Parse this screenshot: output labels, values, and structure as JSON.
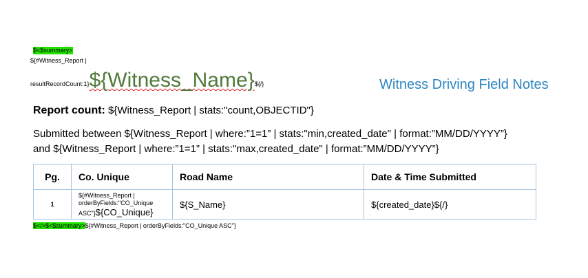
{
  "header": {
    "summary_open_tag": "$<$summary>",
    "witness_report_open_line1": "${#Witness_Report |",
    "witness_report_open_line2": "resultRecordCount:1}",
    "witness_name_field": "${Witness_Name}",
    "close_tag": "${/}",
    "title": "Witness Driving Field Notes"
  },
  "report_count": {
    "label": "Report count:",
    "expression": "${Witness_Report | stats:\"count,OBJECTID\"}"
  },
  "submitted": {
    "line1": "Submitted between ${Witness_Report | where:”1=1” | stats:\"min,created_date\" | format:”MM/DD/YYYY”}",
    "line2": "and ${Witness_Report | where:”1=1” | stats:\"max,created_date\" | format:”MM/DD/YYYY”}"
  },
  "table": {
    "headers": [
      "Pg.",
      "Co. Unique",
      "Road Name",
      "Date & Time Submitted"
    ],
    "row": {
      "pg": "1",
      "co_unique_line1": "${#Witness_Report |",
      "co_unique_line2": "orderByFields:\"CO_Unique",
      "co_unique_line3": "ASC\"}",
      "co_unique_field": "${CO_Unique}",
      "road_name": "${S_Name}",
      "date_time": "${created_date}${/}"
    }
  },
  "footer": {
    "highlighted_tags": "$</>$<$summary>",
    "expression": "${#Witness_Report | orderByFields:\"CO_Unique ASC\"}"
  }
}
